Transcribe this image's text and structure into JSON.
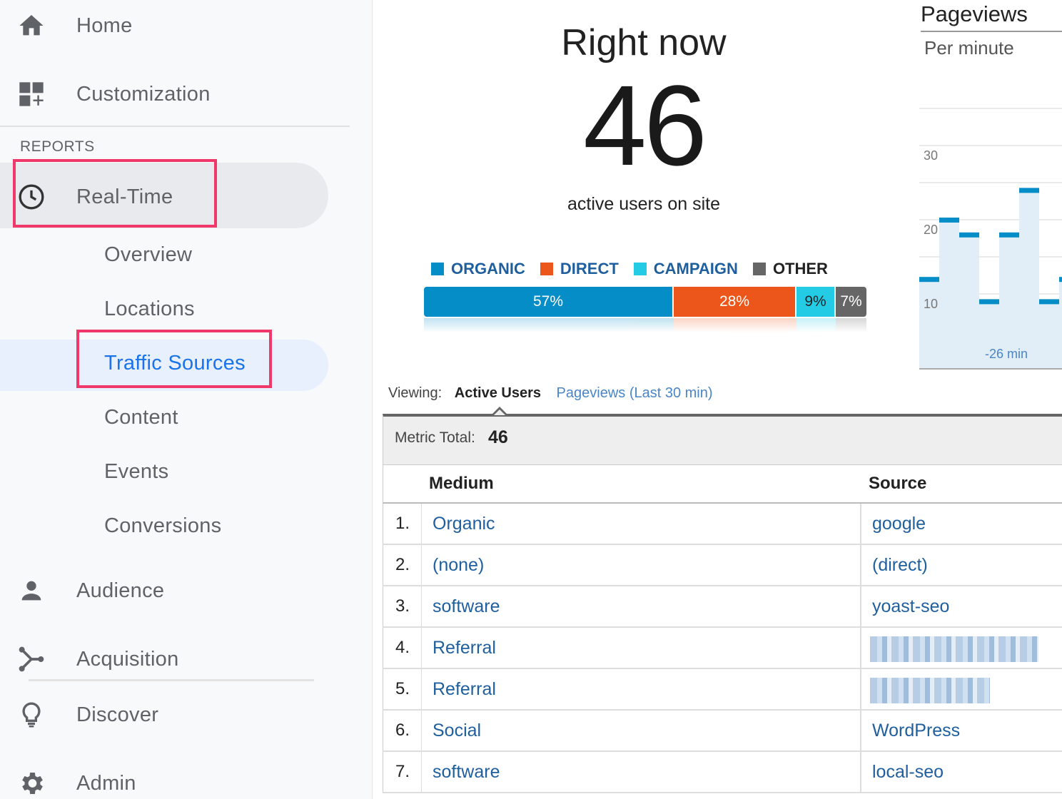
{
  "sidebar": {
    "home": "Home",
    "customization": "Customization",
    "reports_label": "REPORTS",
    "realtime": "Real-Time",
    "sub_items": [
      "Overview",
      "Locations",
      "Traffic Sources",
      "Content",
      "Events",
      "Conversions"
    ],
    "audience": "Audience",
    "acquisition": "Acquisition",
    "discover": "Discover",
    "admin": "Admin"
  },
  "main": {
    "title": "Right now",
    "active_count": "46",
    "active_label": "active users on site",
    "legend": [
      {
        "label": "ORGANIC",
        "color": "#058dc7",
        "text_color": "#1f5f9e"
      },
      {
        "label": "DIRECT",
        "color": "#ed561b",
        "text_color": "#1f5f9e"
      },
      {
        "label": "CAMPAIGN",
        "color": "#24cbe5",
        "text_color": "#1f5f9e"
      },
      {
        "label": "OTHER",
        "color": "#666666",
        "text_color": "#222222"
      }
    ],
    "split": [
      {
        "label": "57%",
        "value": 57,
        "color": "#058dc7",
        "text": "#ffffff"
      },
      {
        "label": "28%",
        "value": 28,
        "color": "#ed561b",
        "text": "#ffffff"
      },
      {
        "label": "9%",
        "value": 9,
        "color": "#24cbe5",
        "text": "#222222"
      },
      {
        "label": "7%",
        "value": 7,
        "color": "#666666",
        "text": "#ffffff"
      }
    ]
  },
  "pageviews": {
    "title": "Pageviews",
    "subtitle": "Per minute",
    "x_tick": "-26 min",
    "chart_data": {
      "type": "bar",
      "y_ticks": [
        10,
        20,
        30
      ],
      "values": [
        12,
        20,
        18,
        9,
        18,
        24,
        9,
        12
      ],
      "ylim": [
        0,
        40
      ]
    }
  },
  "viewing": {
    "label": "Viewing:",
    "selected": "Active Users",
    "other": "Pageviews (Last 30 min)"
  },
  "metric": {
    "label": "Metric Total:",
    "value": "46"
  },
  "table": {
    "headers": [
      "Medium",
      "Source"
    ],
    "rows": [
      {
        "n": "1.",
        "medium": "Organic",
        "source": "google"
      },
      {
        "n": "2.",
        "medium": "(none)",
        "source": "(direct)"
      },
      {
        "n": "3.",
        "medium": "software",
        "source": "yoast-seo"
      },
      {
        "n": "4.",
        "medium": "Referral",
        "source": ""
      },
      {
        "n": "5.",
        "medium": "Referral",
        "source": ""
      },
      {
        "n": "6.",
        "medium": "Social",
        "source": "WordPress"
      },
      {
        "n": "7.",
        "medium": "software",
        "source": "local-seo"
      }
    ]
  }
}
